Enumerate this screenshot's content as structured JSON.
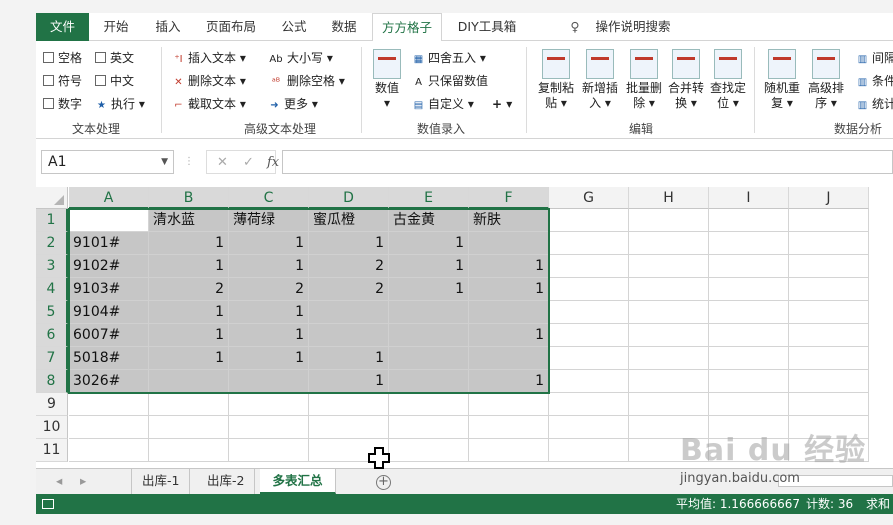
{
  "tabs": {
    "file": "文件",
    "home": "开始",
    "insert": "插入",
    "layout": "页面布局",
    "formulas": "公式",
    "data": "数据",
    "ffgz": "方方格子",
    "diy": "DIY工具箱",
    "tellme": "操作说明搜索"
  },
  "ribbon": {
    "text_group": {
      "space": "空格",
      "english": "英文",
      "symbol": "符号",
      "chinese": "中文",
      "digit": "数字",
      "execute": "执行",
      "label": "文本处理"
    },
    "adv_group": {
      "insert_text": "插入文本",
      "delete_text": "删除文本",
      "extract_text": "截取文本",
      "case": "大小写",
      "del_space": "删除空格",
      "more": "更多",
      "label": "高级文本处理"
    },
    "num_group": {
      "numeric": "数值",
      "round": "四舍五入",
      "keep_num": "只保留数值",
      "custom": "自定义",
      "plus": "+",
      "label": "数值录入"
    },
    "edit_group": {
      "copy_paste": "复制粘贴",
      "new_insert": "新增插入",
      "batch_del": "批量删除",
      "merge_conv": "合并转换",
      "find_locate": "查找定位",
      "label": "编辑"
    },
    "analysis_group": {
      "random_dup": "随机重复",
      "adv_sort": "高级排序",
      "r1": "间隔",
      "r2": "条件",
      "r3": "统计",
      "label": "数据分析"
    }
  },
  "formula_bar": {
    "name_box": "A1",
    "fx": "fx",
    "formula": ""
  },
  "columns": [
    "A",
    "B",
    "C",
    "D",
    "E",
    "F",
    "G",
    "H",
    "I",
    "J"
  ],
  "rows": [
    "1",
    "2",
    "3",
    "4",
    "5",
    "6",
    "7",
    "8",
    "9",
    "10",
    "11"
  ],
  "cells": [
    [
      "",
      "清水蓝",
      "薄荷绿",
      "蜜瓜橙",
      "古金黄",
      "新肤"
    ],
    [
      "9101#",
      "1",
      "1",
      "1",
      "1",
      ""
    ],
    [
      "9102#",
      "1",
      "1",
      "2",
      "1",
      "1"
    ],
    [
      "9103#",
      "2",
      "2",
      "2",
      "1",
      "1"
    ],
    [
      "9104#",
      "1",
      "1",
      "",
      "",
      ""
    ],
    [
      "6007#",
      "1",
      "1",
      "",
      "",
      "1"
    ],
    [
      "5018#",
      "1",
      "1",
      "1",
      "",
      ""
    ],
    [
      "3026#",
      "",
      "",
      "1",
      "",
      "1"
    ]
  ],
  "sheets": {
    "s1": "出库-1",
    "s2": "出库-2",
    "s3": "多表汇总",
    "add": "+"
  },
  "status": {
    "average": "平均值: 1.166666667",
    "count": "计数: 36",
    "sum": "求和"
  },
  "watermark": {
    "brand": "Bai du 经验",
    "url": "jingyan.baidu.com"
  },
  "colors": {
    "excel_green": "#217346",
    "selection_shade": "#c6c6c6"
  }
}
